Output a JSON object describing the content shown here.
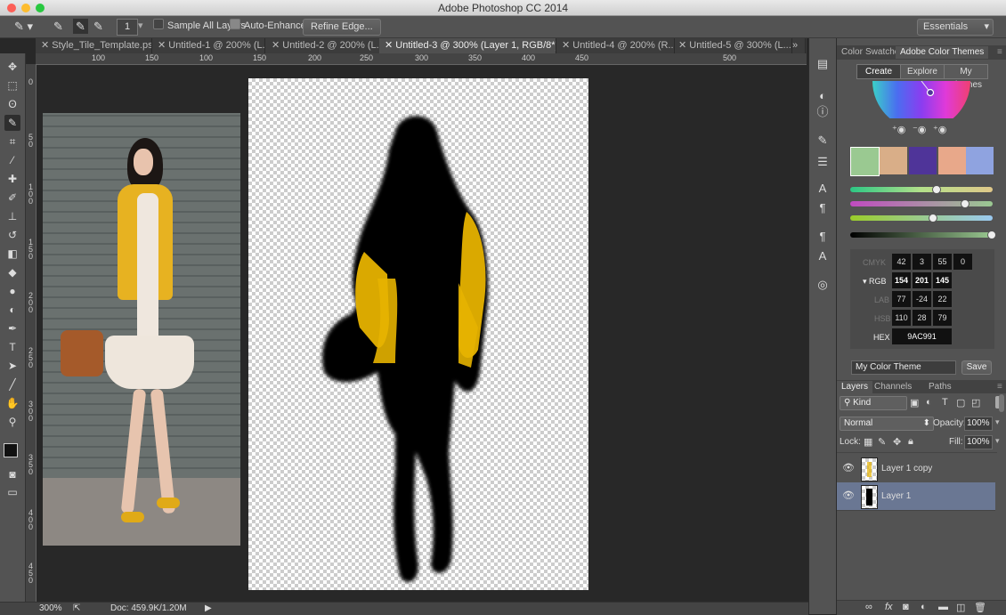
{
  "window": {
    "title": "Adobe Photoshop CC 2014"
  },
  "colors": {
    "close": "#fc5f57",
    "minimize": "#fdbc2e",
    "maximize": "#28c840",
    "panel": "#535353",
    "layer_selected": "#6a7793"
  },
  "options_bar": {
    "brush_size": "1",
    "sample_all_layers": {
      "label": "Sample All Layers",
      "checked": false
    },
    "auto_enhance": {
      "label": "Auto-Enhance",
      "checked": true
    },
    "refine_edge": "Refine Edge...",
    "workspace": "Essentials"
  },
  "tabs": [
    {
      "label": "Style_Tile_Template.psd",
      "active": false
    },
    {
      "label": "Untitled-1 @ 200% (L...",
      "active": false
    },
    {
      "label": "Untitled-2 @ 200% (L...",
      "active": false
    },
    {
      "label": "Untitled-3 @ 300% (Layer 1, RGB/8*) *",
      "active": true
    },
    {
      "label": "Untitled-4 @ 200% (R...",
      "active": false
    },
    {
      "label": "Untitled-5 @ 300% (L...",
      "active": false
    }
  ],
  "ruler_h": [
    "100",
    "150",
    "100",
    "150",
    "200",
    "250",
    "300",
    "350",
    "400",
    "450",
    "500"
  ],
  "ruler_v": [
    "0",
    "5\n0",
    "1\n0\n0",
    "1\n5\n0",
    "2\n0\n0",
    "2\n5\n0",
    "3\n0\n0",
    "3\n5\n0",
    "4\n0\n0",
    "4\n5\n0"
  ],
  "status": {
    "zoom": "300%",
    "doc": "Doc: 459.9K/1.20M"
  },
  "color_panel": {
    "tabs": [
      "Color",
      "Swatche",
      "Adobe Color Themes"
    ],
    "modes": [
      "Create",
      "Explore",
      "My Themes"
    ],
    "swatches": [
      "#9ac991",
      "#d9ae88",
      "#4f3499",
      "#e8a88a",
      "#8fa3e0"
    ],
    "values": {
      "cmyk": {
        "label": "CMYK",
        "values": [
          "42",
          "3",
          "55",
          "0"
        ]
      },
      "rgb": {
        "label": "RGB",
        "values": [
          "154",
          "201",
          "145"
        ]
      },
      "lab": {
        "label": "LAB",
        "values": [
          "77",
          "-24",
          "22"
        ]
      },
      "hsb": {
        "label": "HSB",
        "values": [
          "110",
          "28",
          "79"
        ]
      },
      "hex": {
        "label": "HEX",
        "value": "9AC991"
      }
    },
    "theme_name": "My Color Theme",
    "save": "Save"
  },
  "layers_panel": {
    "tabs": [
      "Layers",
      "Channels",
      "Paths"
    ],
    "filter": "Kind",
    "blend_mode": "Normal",
    "opacity_label": "Opacity:",
    "opacity": "100%",
    "lock_label": "Lock:",
    "fill_label": "Fill:",
    "fill": "100%",
    "layers": [
      {
        "name": "Layer 1 copy",
        "selected": false
      },
      {
        "name": "Layer 1",
        "selected": true
      }
    ]
  }
}
